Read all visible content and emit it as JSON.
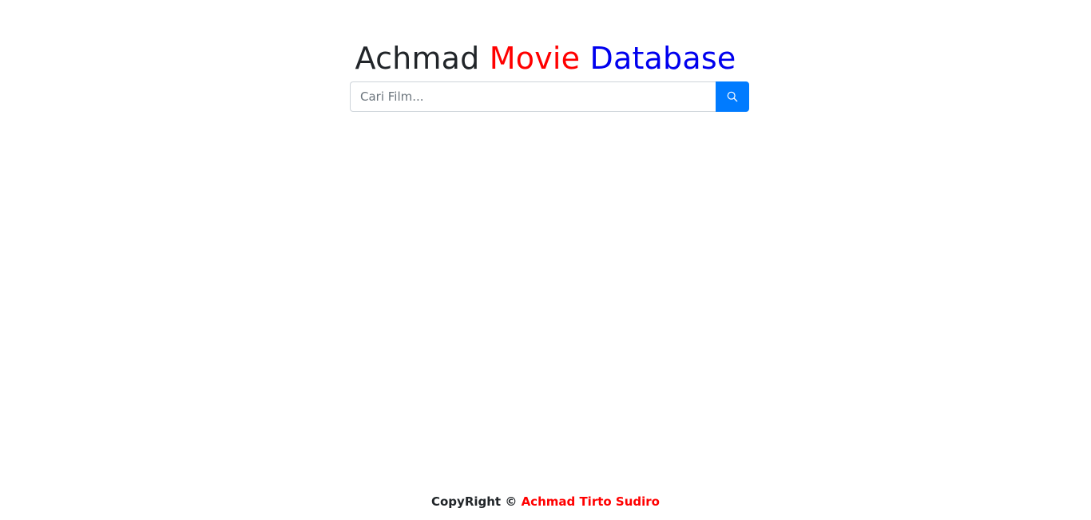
{
  "header": {
    "title_word1": "Achmad",
    "title_word2": "Movie",
    "title_word3": "Database"
  },
  "search": {
    "placeholder": "Cari Film...",
    "value": "",
    "button_icon": "search-icon"
  },
  "footer": {
    "copyright_label": "CopyRight ©",
    "author": "Achmad Tirto Sudiro"
  },
  "colors": {
    "brand_red": "#ff0000",
    "brand_blue": "#0000ee",
    "button_primary": "#007bff"
  }
}
